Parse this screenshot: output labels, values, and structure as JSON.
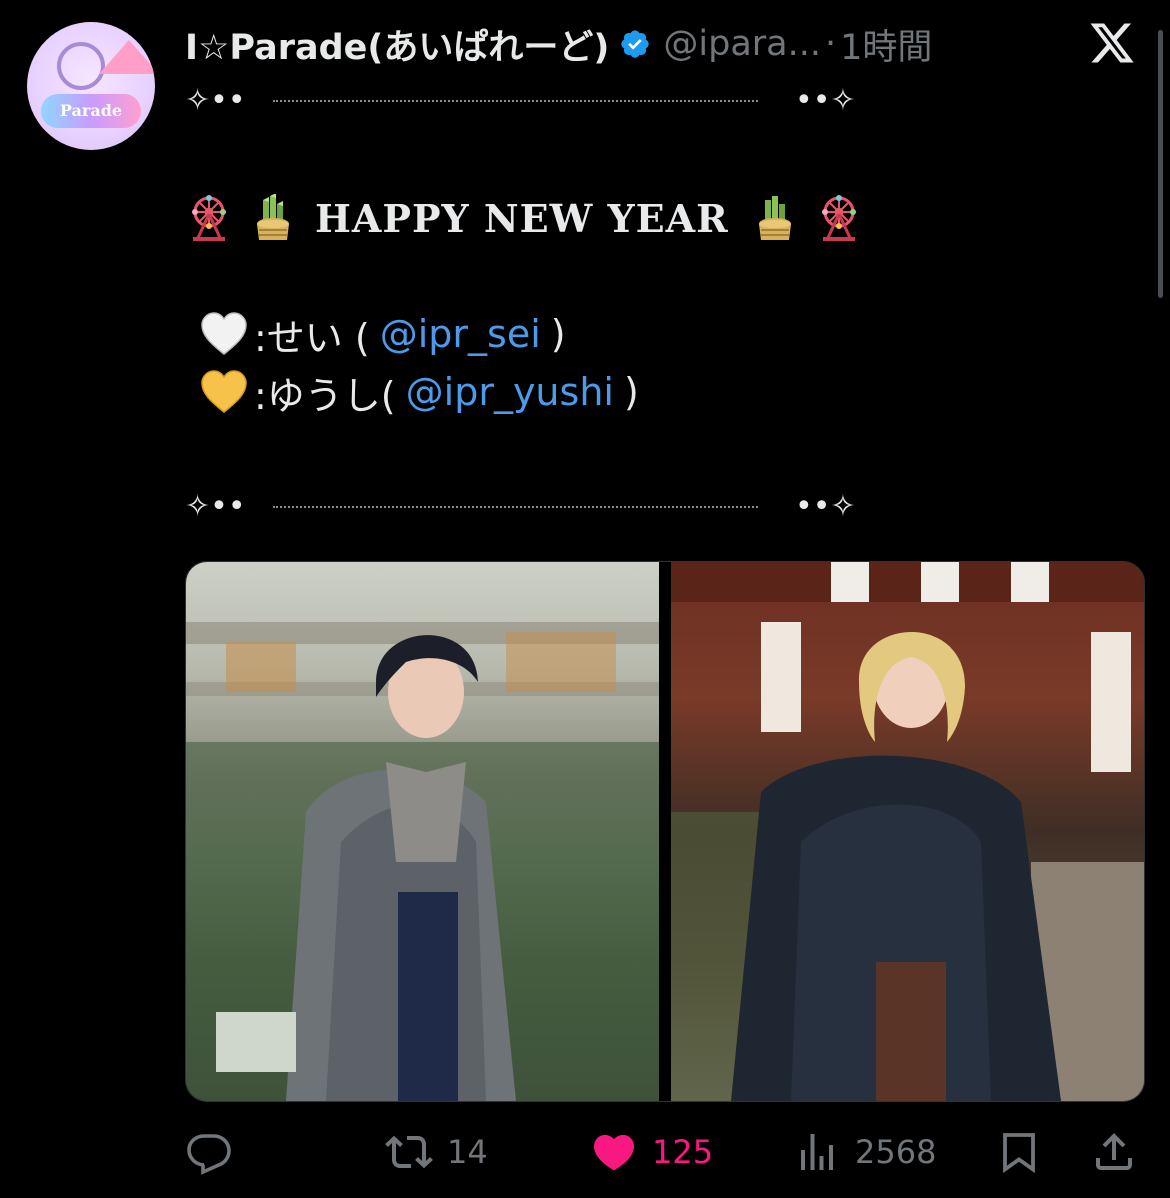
{
  "account": {
    "display_name": "I☆Parade(あいぱれーど)",
    "handle": "@ipara...",
    "separator": "·",
    "time": "1時間",
    "avatar_text": "Parade",
    "verified": true
  },
  "tweet": {
    "decor_left": "✧••",
    "decor_right": "••✧",
    "greeting": "HAPPY NEW YEAR",
    "members": [
      {
        "heart_color": "#f2f2f2",
        "name": ":せい (",
        "mention": "@ipr_sei",
        "close": ")"
      },
      {
        "heart_color": "#f7c24a",
        "name": ":ゆうし(",
        "mention": "@ipr_yushi",
        "close": ")"
      }
    ]
  },
  "actions": {
    "reply_count": "",
    "retweet_count": "14",
    "like_count": "125",
    "views_count": "2568"
  },
  "colors": {
    "background": "#000000",
    "text": "#e7e9ea",
    "secondary": "#71767b",
    "link": "#4d9ae8",
    "like": "#f91880",
    "verified": "#1d9bf0"
  },
  "icons": [
    "verified-badge-icon",
    "x-logo-icon",
    "ferris-wheel-icon",
    "kadomatsu-icon",
    "white-heart-icon",
    "yellow-heart-icon",
    "reply-icon",
    "retweet-icon",
    "like-icon",
    "views-icon",
    "bookmark-icon",
    "share-icon"
  ]
}
